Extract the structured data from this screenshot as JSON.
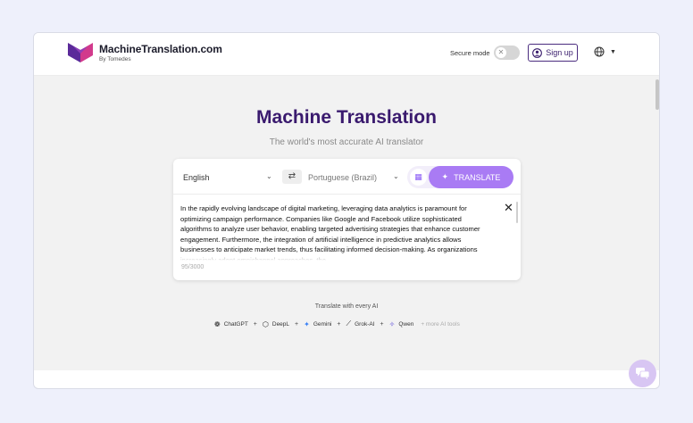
{
  "header": {
    "brand_title": "MachineTranslation.com",
    "brand_subtitle": "By Tomedes",
    "secure_mode_label": "Secure mode",
    "secure_mode_on": false,
    "signup_label": "Sign up"
  },
  "hero": {
    "title": "Machine Translation",
    "subtitle": "The world's most accurate AI translator"
  },
  "translator": {
    "source_language": "English",
    "target_language": "Portuguese (Brazil)",
    "translate_label": "TRANSLATE",
    "source_text": "In the rapidly evolving landscape of digital marketing, leveraging data analytics is paramount for optimizing campaign performance. Companies like Google and Facebook utilize sophisticated algorithms to analyze user behavior, enabling targeted advertising strategies that enhance customer engagement. Furthermore, the integration of artificial intelligence in predictive analytics allows businesses to anticipate market trends, thus facilitating informed decision-making. As organizations increasingly adopt omnichannel approaches, the",
    "char_count": "95/3000"
  },
  "ai_section": {
    "label": "Translate with every AI",
    "tools": [
      {
        "name": "ChatGPT",
        "icon": "openai-icon"
      },
      {
        "name": "DeepL",
        "icon": "deepl-icon"
      },
      {
        "name": "Gemini",
        "icon": "gemini-icon"
      },
      {
        "name": "Grok-AI",
        "icon": "grok-icon"
      },
      {
        "name": "Qwen",
        "icon": "qwen-icon"
      }
    ],
    "more_label": "+ more AI tools"
  },
  "colors": {
    "brand_purple": "#3a1a6e",
    "translate_button": "#a97bf4",
    "page_background": "#eef0fb"
  }
}
